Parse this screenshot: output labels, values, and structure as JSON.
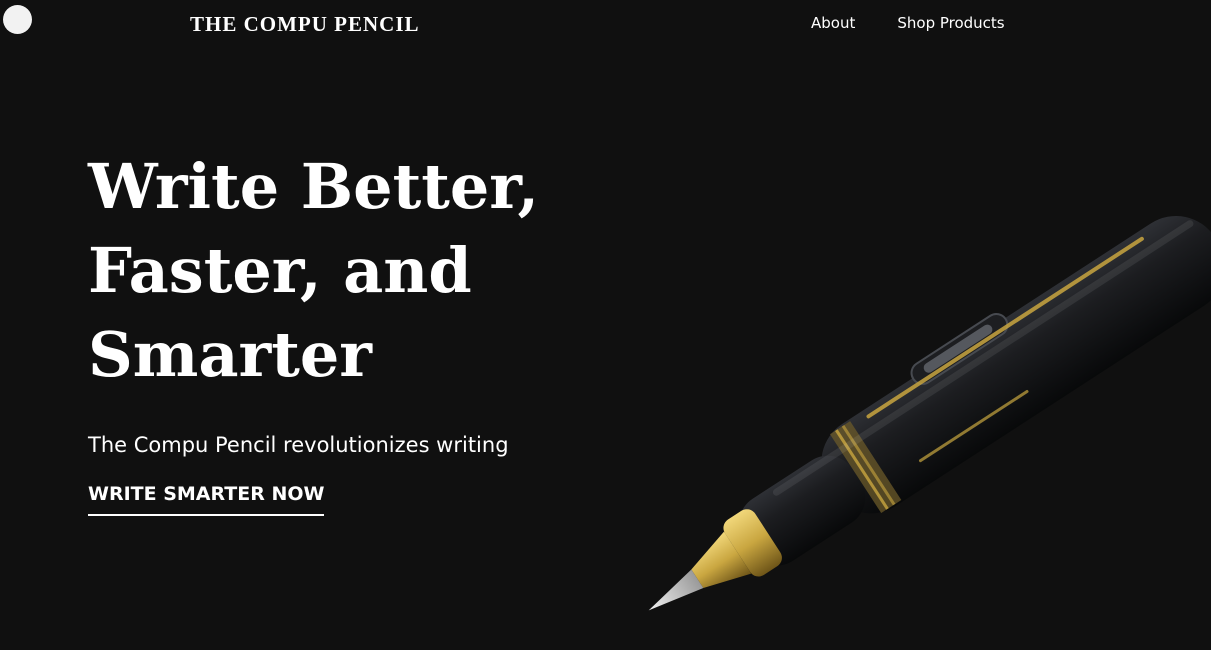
{
  "header": {
    "brand": "THE COMPU PENCIL",
    "nav": [
      {
        "label": "About"
      },
      {
        "label": "Shop Products"
      }
    ]
  },
  "hero": {
    "headline_lines": [
      "Write Better,",
      "Faster, and",
      "Smarter"
    ],
    "subtitle": "The Compu Pencil revolutionizes writing",
    "cta": "WRITE SMARTER NOW"
  },
  "icons": {
    "menu": "circle-menu-icon",
    "hero_image": "fountain-pen-image"
  },
  "colors": {
    "background": "#101010",
    "text": "#ffffff",
    "menu_dot": "#f2f2f2",
    "pen_accent": "#c9a640"
  }
}
